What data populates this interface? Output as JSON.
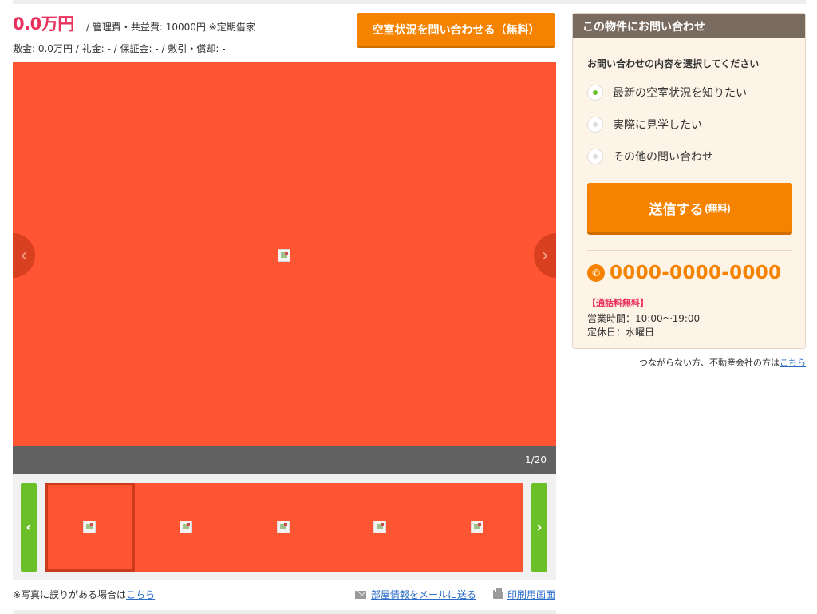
{
  "summary": {
    "price": "0.0万円",
    "fees": "/ 管理費・共益費: 10000円 ※定期借家",
    "deposits": "敷金: 0.0万円  / 礼金: -  / 保証金: -  / 敷引・償却: -",
    "vacancy_button": "空室状況を問い合わせる（無料）"
  },
  "gallery": {
    "counter": "1/20",
    "prev_arrow": "‹",
    "next_arrow": "›",
    "thumb_prev": "‹",
    "thumb_next": "›",
    "thumbnail_count": 5,
    "active_thumbnail": 1,
    "image_color": "#ff5533"
  },
  "footer_links": {
    "photo_note": "※写真に誤りがある場合は",
    "photo_note_link": "こちら",
    "mail_link": "部屋情報をメールに送る",
    "print_link": "印刷用画面"
  },
  "inquiry": {
    "title": "この物件にお問い合わせ",
    "prompt": "お問い合わせの内容を選択してください",
    "options": [
      {
        "label": "最新の空室状況を知りたい",
        "checked": true
      },
      {
        "label": "実際に見学したい",
        "checked": false
      },
      {
        "label": "その他の問い合わせ",
        "checked": false
      }
    ],
    "send_label": "送信する",
    "send_suffix": "(無料)",
    "phone": "0000-0000-0000",
    "free_call": "【通話料無料】",
    "hours": "営業時間：10:00〜19:00",
    "holiday": "定休日：水曜日",
    "alt_text": "つながらない方、不動産会社の方は",
    "alt_link": "こちら"
  },
  "colors": {
    "accent_orange": "#f58300",
    "price_pink": "#e8315d",
    "nav_green": "#6bbf29",
    "header_brown": "#7a6b60",
    "image_placeholder": "#ff5533"
  },
  "icons": {
    "phone": "phone-icon",
    "mail": "mail-icon",
    "print": "printer-icon",
    "broken_image": "broken-image-icon"
  }
}
